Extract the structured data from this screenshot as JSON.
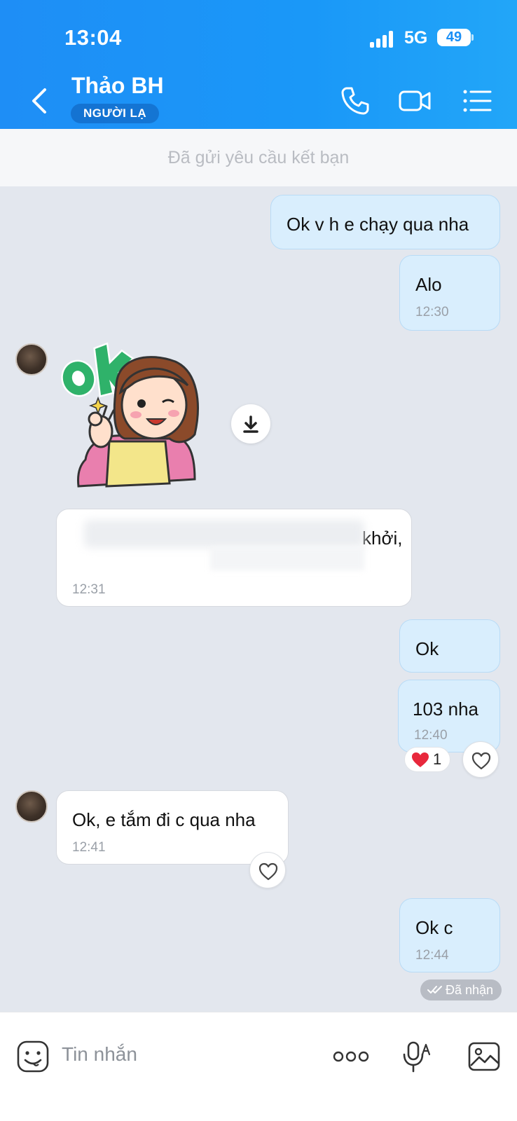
{
  "status_bar": {
    "time": "13:04",
    "network": "5G",
    "battery": "49"
  },
  "header": {
    "contact_name": "Thảo BH",
    "badge": "NGƯỜI LẠ"
  },
  "friend_request_notice": "Đã gửi yêu cầu kết bạn",
  "messages": [
    {
      "id": "m1",
      "direction": "outgoing",
      "text": "Ok v h e chạy qua nha"
    },
    {
      "id": "m2",
      "direction": "outgoing",
      "text": "Alo",
      "time": "12:30"
    },
    {
      "id": "m3",
      "direction": "incoming",
      "type": "sticker",
      "sticker_text": "ok"
    },
    {
      "id": "m4",
      "direction": "incoming",
      "text": "khởi,",
      "time": "12:31",
      "blurred": true
    },
    {
      "id": "m5",
      "direction": "outgoing",
      "text": "Ok"
    },
    {
      "id": "m6",
      "direction": "outgoing",
      "text": "103 nha",
      "time": "12:40",
      "reaction": {
        "emoji": "heart",
        "count": "1"
      }
    },
    {
      "id": "m7",
      "direction": "incoming",
      "text": "Ok, e tắm đi c qua nha",
      "time": "12:41"
    },
    {
      "id": "m8",
      "direction": "outgoing",
      "text": "Ok c",
      "time": "12:44"
    }
  ],
  "delivery_status": "Đã nhận",
  "composer": {
    "placeholder": "Tin nhắn"
  },
  "colors": {
    "header_blue": "#1a8ff6",
    "outgoing_bubble": "#d9eefd",
    "incoming_bubble": "#ffffff",
    "reaction_heart": "#e8283c"
  }
}
